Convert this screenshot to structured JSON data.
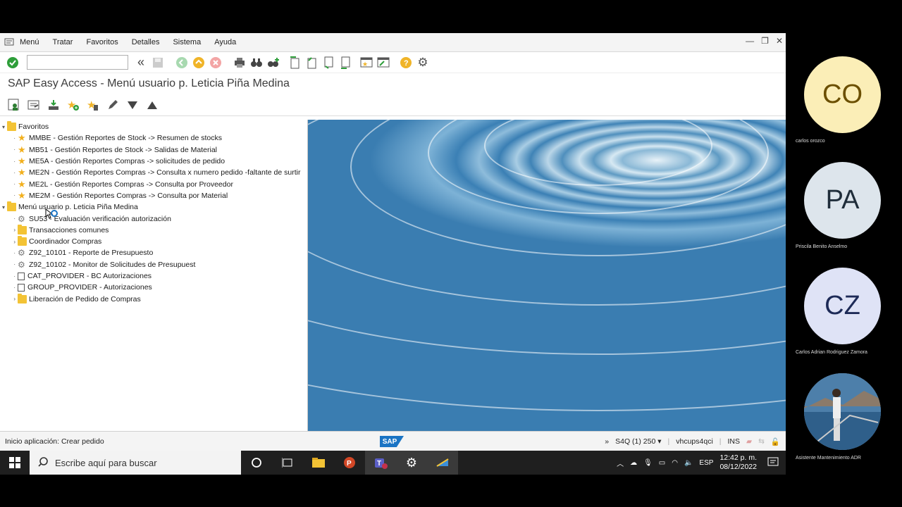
{
  "menubar": {
    "items": [
      "Menú",
      "Tratar",
      "Favoritos",
      "Detalles",
      "Sistema",
      "Ayuda"
    ]
  },
  "toolbar": {
    "command_value": ""
  },
  "title": "SAP Easy Access  -  Menú usuario p. Leticia Piña Medina",
  "tree": {
    "favorites_label": "Favoritos",
    "favorites": [
      "MMBE - Gestión Reportes de Stock -> Resumen de stocks",
      "MB51 - Gestión Reportes de Stock -> Salidas de Material",
      "ME5A - Gestión Reportes Compras ->  solicitudes de pedido",
      "ME2N - Gestión Reportes Compras -> Consulta x numero pedido -faltante de surtir",
      "ME2L - Gestión Reportes Compras -> Consulta por Proveedor",
      "ME2M - Gestión Reportes Compras -> Consulta por Material"
    ],
    "user_menu_label": "Menú usuario p. Leticia Piña Medina",
    "user_menu": [
      {
        "label": "SU53 - Evaluación verificación autorización",
        "icon": "gear-icon"
      },
      {
        "label": "Transacciones comunes",
        "icon": "folder-icon"
      },
      {
        "label": "Coordinador Compras",
        "icon": "folder-icon"
      },
      {
        "label": "Z92_10101 - Reporte de Presupuesto",
        "icon": "gear-icon"
      },
      {
        "label": "Z92_10102 - Monitor de Solicitudes de Presupuest",
        "icon": "gear-icon"
      },
      {
        "label": "CAT_PROVIDER - BC Autorizaciones",
        "icon": "document-icon"
      },
      {
        "label": "GROUP_PROVIDER - Autorizaciones",
        "icon": "document-icon"
      },
      {
        "label": "Liberación de Pedido de Compras",
        "icon": "folder-icon"
      }
    ]
  },
  "status": {
    "message": "Inicio aplicación: Crear pedido",
    "logo": "SAP",
    "system": "S4Q (1) 250",
    "server": "vhcups4qci",
    "mode": "INS"
  },
  "taskbar": {
    "search_placeholder": "Escribe aquí para buscar",
    "language": "ESP",
    "time": "12:42 p. m.",
    "date": "08/12/2022"
  },
  "participants": [
    {
      "initials": "CO",
      "name": "carlos orozco",
      "color": "#fbeeb7",
      "text_color": "#6b4f00"
    },
    {
      "initials": "PA",
      "name": "Priscila Benito Anselmo",
      "color": "#dde5ec",
      "text_color": "#1f2d3a"
    },
    {
      "initials": "CZ",
      "name": "Carlos Adrian Rodriguez Zamora",
      "color": "#dfe3f6",
      "text_color": "#1d2a57"
    },
    {
      "initials": "",
      "name": "Asistente Mantenimiento ADR",
      "color": "#8fb2cf",
      "text_color": "#000"
    }
  ]
}
